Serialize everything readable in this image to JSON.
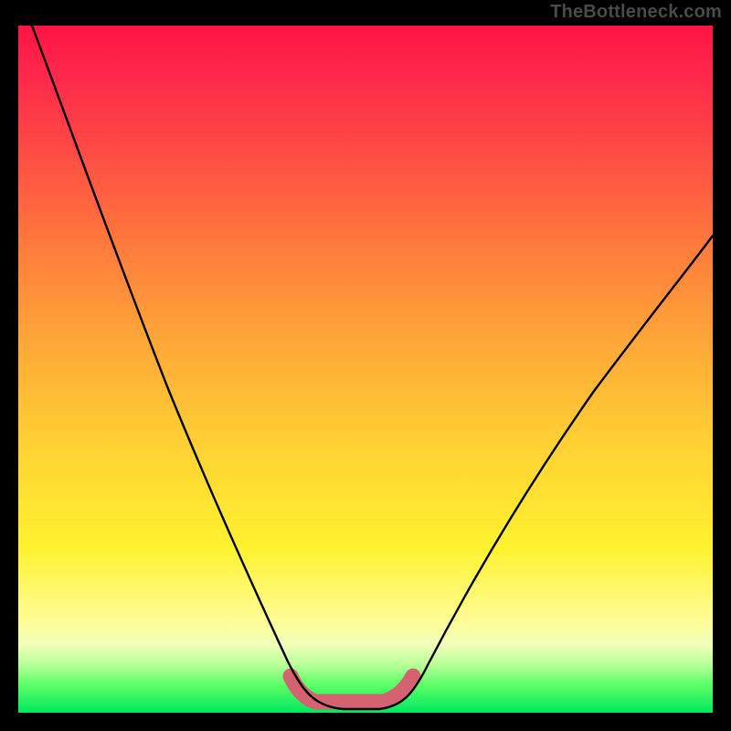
{
  "watermark": {
    "text": "TheBottleneck.com"
  },
  "chart_data": {
    "type": "line",
    "title": "",
    "xlabel": "",
    "ylabel": "",
    "xlim": [
      0,
      100
    ],
    "ylim": [
      0,
      100
    ],
    "series": [
      {
        "name": "bottleneck-curve",
        "x": [
          2,
          5,
          10,
          15,
          20,
          25,
          30,
          35,
          38,
          41,
          44,
          47,
          50,
          53,
          57,
          62,
          68,
          75,
          82,
          90,
          100
        ],
        "y": [
          100,
          90,
          78,
          66,
          55,
          44,
          34,
          22,
          12,
          6,
          2,
          1,
          1,
          2,
          5,
          12,
          22,
          33,
          43,
          52,
          62
        ]
      },
      {
        "name": "optimal-band",
        "x": [
          40,
          42,
          44,
          47,
          50,
          53,
          55,
          57
        ],
        "y": [
          6,
          3,
          1.5,
          1,
          1,
          1.5,
          3,
          6
        ]
      }
    ],
    "colors": {
      "curve": "#000000",
      "band": "#d4626f",
      "bg_top": "#ff1445",
      "bg_mid": "#ffd333",
      "bg_bottom": "#00e85e"
    }
  }
}
